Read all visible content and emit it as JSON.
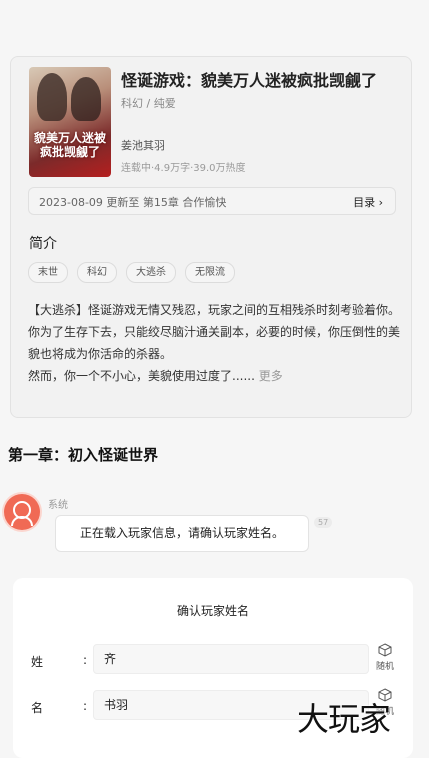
{
  "book": {
    "title": "怪诞游戏：貌美万人迷被疯批觊觎了",
    "genre": "科幻 / 纯爱",
    "author": "姜池其羽",
    "stats": "连载中·4.9万字·39.0万热度",
    "cover_title": "貌美万人迷被疯批觊觎了"
  },
  "update": {
    "text": "2023-08-09  更新至 第15章 合作愉快",
    "toc_label": "目录"
  },
  "intro": {
    "heading": "简介",
    "tags": [
      "末世",
      "科幻",
      "大逃杀",
      "无限流"
    ],
    "lines": [
      "【大逃杀】怪诞游戏无情又残忍，玩家之间的互相残杀时刻考验着你。你为了生存下去，只能绞尽脑汁通关副本，必要的时候，你压倒性的美貌也将成为你活命的杀器。",
      "然而，你一个不小心，美貌使用过度了......"
    ],
    "more_label": "更多"
  },
  "chapter": {
    "title": "第一章：初入怪诞世界"
  },
  "message": {
    "sender": "系统",
    "text": "正在载入玩家信息，请确认玩家姓名。",
    "badge": "57"
  },
  "form": {
    "heading": "确认玩家姓名",
    "fields": [
      {
        "label": "姓",
        "value": "齐",
        "random_label": "随机"
      },
      {
        "label": "名",
        "value": "书羽",
        "random_label": "随机"
      }
    ]
  },
  "watermark": "大玩家"
}
